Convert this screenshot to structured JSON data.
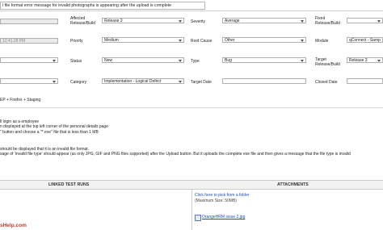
{
  "summary": {
    "value": "l file format error message for invalid photographs is appearing after the upload is complete"
  },
  "row1": {
    "left_value": "",
    "affected_label": "Affected Release/Build",
    "affected_value": "Release 3",
    "severity_label": "Severity",
    "severity_value": "Average",
    "fixed_label": "Fixed Release/Build",
    "fixed_value": ""
  },
  "row2": {
    "left_value": "12:41:28 PM",
    "priority_label": "Priority",
    "priority_value": "Medium",
    "rootcause_label": "Root Cause",
    "rootcause_value": "Other",
    "module_label": "Module",
    "module_value": "qConnect - Samp"
  },
  "row3": {
    "status_label": "Status",
    "status_value": "New",
    "type_label": "Type",
    "type_value": "Bug",
    "target_label": "Target Release/Build",
    "target_value": "Release 3"
  },
  "row4": {
    "category_label": "Category",
    "category_value": "Implementation - Logical Defect",
    "targetdate_label": "Target Date",
    "targetdate_value": "",
    "closeddate_label": "Closed Date",
    "closeddate_value": ""
  },
  "environment": {
    "value": "EP + Firefox + Staging"
  },
  "steps": [
    "ll login as a employee",
    "n displayed at the top left corner of the personal details page",
    "\" button and choose a \"*.exe\" file that is less than 1 MB"
  ],
  "expected": [
    "should be displayed that it is an invalid file format.",
    "sage of 'invalid file type' should appear (as only JPG, GIF and PNG files supported) after the Upload button. But it uploads the complete exe file and then gives a message that the file type is invalid"
  ],
  "tabs": {
    "linked_runs": "LINKED TEST RUNS",
    "attachments": "ATTACHMENTS"
  },
  "attachments": {
    "pick_link": "Click here to pick from a folder",
    "max_size": "(Maximum Size: 50MB)",
    "file_name": "OrangeHRM issue 2.jpg"
  },
  "footer": {
    "watermark": "sHelp.com"
  }
}
